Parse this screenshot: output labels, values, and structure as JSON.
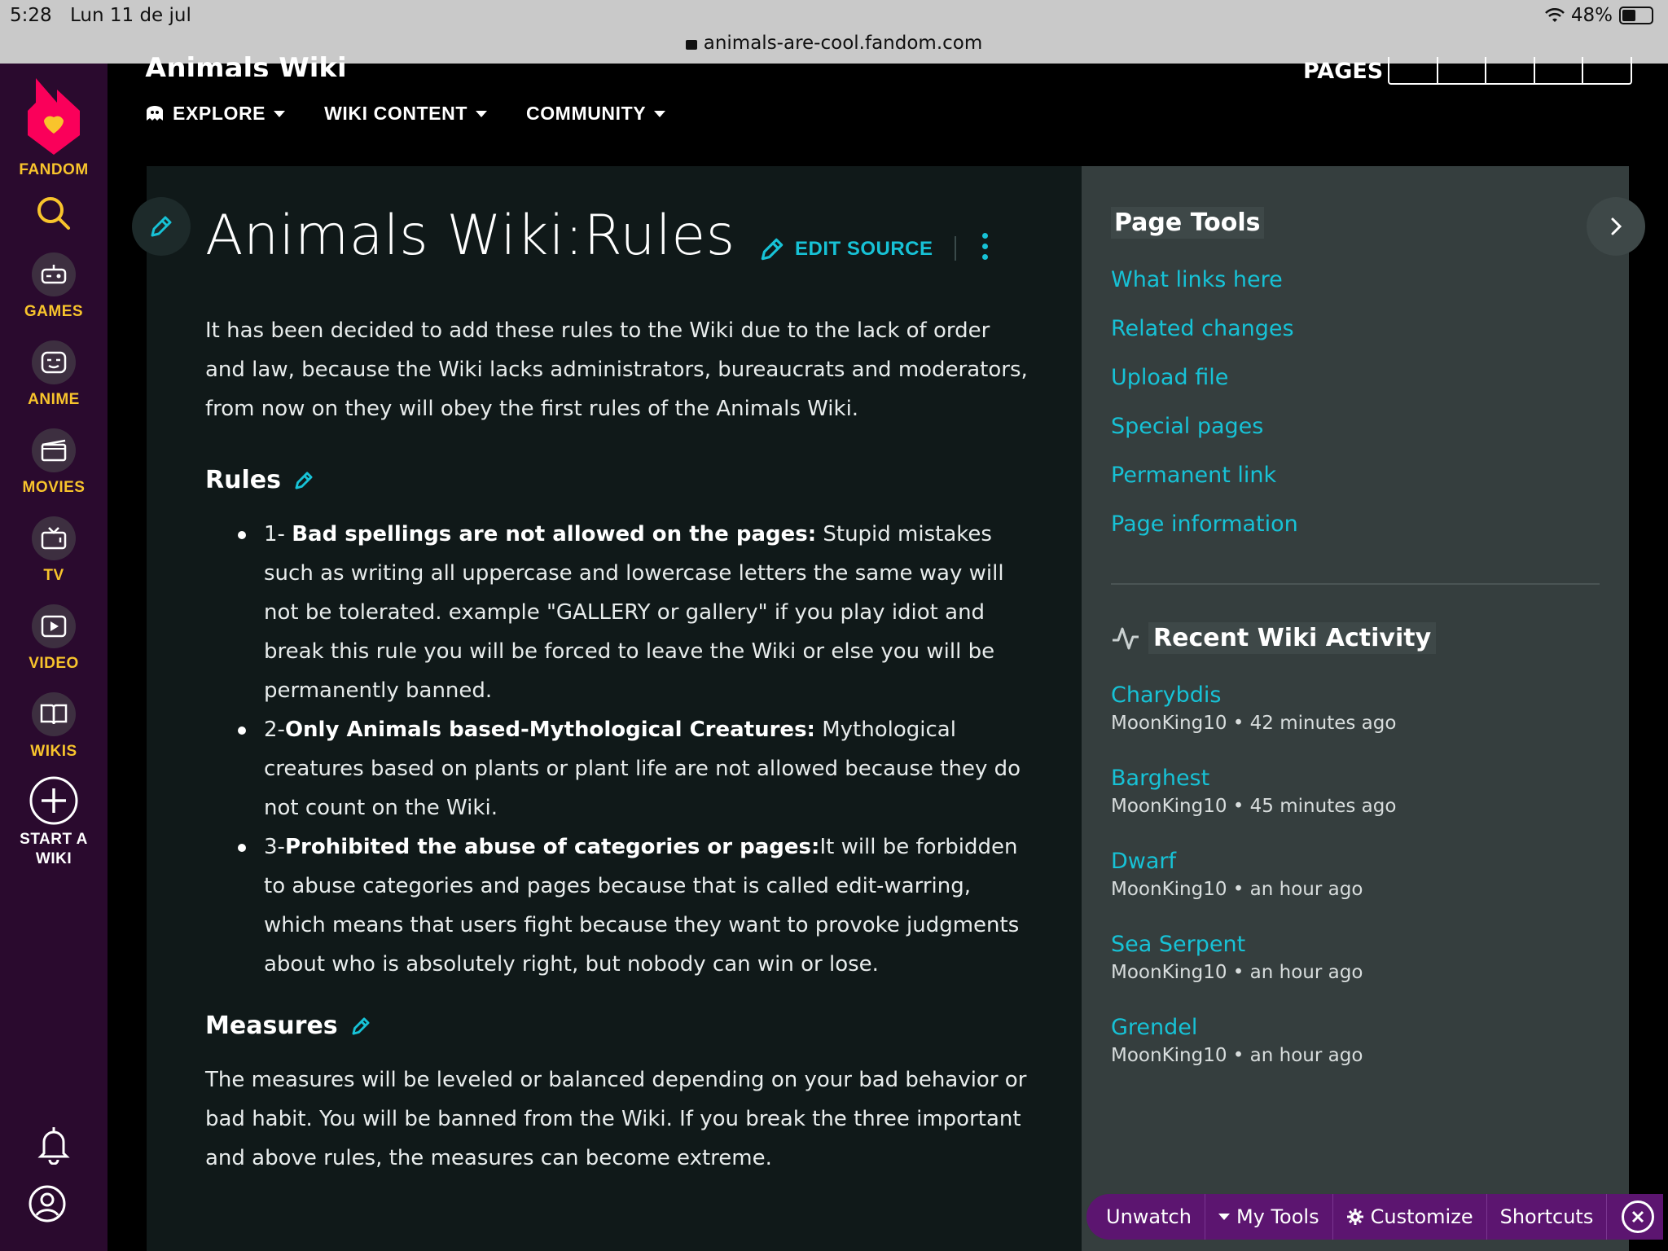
{
  "status": {
    "time": "5:28",
    "date": "Lun 11 de jul",
    "battery": "48%"
  },
  "browser": {
    "url": "animals-are-cool.fandom.com"
  },
  "rail": {
    "brand": "FANDOM",
    "items": [
      {
        "label": "GAMES",
        "icon": "gamepad-icon"
      },
      {
        "label": "ANIME",
        "icon": "anime-face-icon"
      },
      {
        "label": "MOVIES",
        "icon": "clapperboard-icon"
      },
      {
        "label": "TV",
        "icon": "tv-icon"
      },
      {
        "label": "VIDEO",
        "icon": "play-icon"
      },
      {
        "label": "WIKIS",
        "icon": "book-icon"
      }
    ],
    "start_wiki_line1": "START A",
    "start_wiki_line2": "WIKI"
  },
  "wikibar": {
    "title": "Animals Wiki",
    "pages_label": "PAGES",
    "nav": [
      {
        "label": "EXPLORE"
      },
      {
        "label": "WIKI CONTENT"
      },
      {
        "label": "COMMUNITY"
      }
    ]
  },
  "article": {
    "title": "Animals Wiki:Rules",
    "edit_source": "EDIT SOURCE",
    "intro": "It has been decided to add these rules to the Wiki due to the lack of order and law, because the Wiki lacks administrators, bureaucrats and moderators, from now on they will obey the first rules of the Animals Wiki.",
    "rules_heading": "Rules",
    "rules": [
      {
        "prefix": "1- ",
        "bold": "Bad spellings are not allowed on the pages:",
        "text": " Stupid mistakes such as writing all uppercase and lowercase letters the same way will not be tolerated. example \"GALLERY or gallery\" if you play idiot and break this rule you will be forced to leave the Wiki or else you will be permanently banned."
      },
      {
        "prefix": "2-",
        "bold": "Only Animals based-Mythological Creatures:",
        "text": " Mythological creatures based on plants or plant life are not allowed because they do not count on the Wiki."
      },
      {
        "prefix": "3-",
        "bold": "Prohibited the abuse of categories or pages:",
        "text": "It will be forbidden to abuse categories and pages because that is called edit-warring, which means that users fight because they want to provoke judgments about who is absolutely right, but nobody can win or lose."
      }
    ],
    "measures_heading": "Measures",
    "measures": "The measures will be leveled or balanced depending on your bad behavior or bad habit. You will be banned from the Wiki. If you break the three important and above rules, the measures can become extreme."
  },
  "page_tools": {
    "title": "Page Tools",
    "links": [
      "What links here",
      "Related changes",
      "Upload file",
      "Special pages",
      "Permanent link",
      "Page information"
    ]
  },
  "activity": {
    "title": "Recent Wiki Activity",
    "items": [
      {
        "page": "Charybdis",
        "meta": "MoonKing10 • 42 minutes ago"
      },
      {
        "page": "Barghest",
        "meta": "MoonKing10 • 45 minutes ago"
      },
      {
        "page": "Dwarf",
        "meta": "MoonKing10 • an hour ago"
      },
      {
        "page": "Sea Serpent",
        "meta": "MoonKing10 • an hour ago"
      },
      {
        "page": "Grendel",
        "meta": "MoonKing10 • an hour ago"
      }
    ]
  },
  "toolbar": {
    "unwatch": "Unwatch",
    "my_tools": "My Tools",
    "customize": "Customize",
    "shortcuts": "Shortcuts"
  },
  "colors": {
    "link": "#17c2d6",
    "rail_accent": "#f8c42c",
    "rail_bg": "#2a0a2e",
    "toolbar_bg": "#5c1570"
  }
}
